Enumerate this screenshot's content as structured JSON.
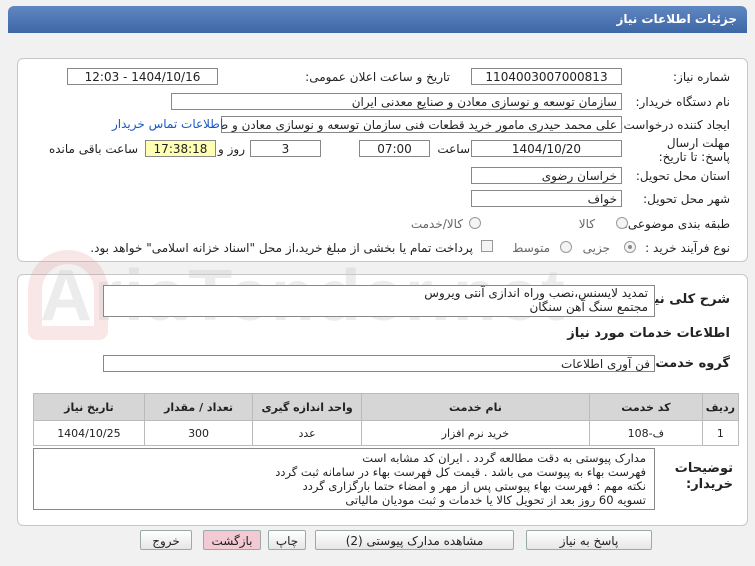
{
  "header": {
    "title": "جزئیات اطلاعات نیاز"
  },
  "form": {
    "need_number_label": "شماره نیاز:",
    "need_number": "1104003007000813",
    "announce_label": "تاریخ و ساعت اعلان عمومی:",
    "announce_value": "1404/10/16 - 12:03",
    "buyer_org_label": "نام دستگاه خریدار:",
    "buyer_org": "سازمان توسعه و نوسازی معادن و صنایع معدنی ایران",
    "creator_label": "ایجاد کننده درخواست:",
    "creator": "علی محمد حیدری مامور خرید قطعات فنی سازمان توسعه و نوسازی معادن و ص",
    "contact_link": "اطلاعات تماس خریدار",
    "deadline_label": "مهلت ارسال پاسخ: تا تاریخ:",
    "deadline_date": "1404/10/20",
    "time_label": "ساعت",
    "deadline_time": "07:00",
    "days_value": "3",
    "days_label": "روز و",
    "remaining_time": "17:38:18",
    "remaining_label": "ساعت باقی مانده",
    "province_label": "استان محل تحویل:",
    "province": "خراسان رضوی",
    "city_label": "شهر محل تحویل:",
    "city": "خواف",
    "category_label": "طبقه بندی موضوعی:",
    "category_options": [
      "کالا",
      "کالا/خدمت"
    ],
    "process_label": "نوع فرآیند خرید :",
    "process_options": [
      "جزیی",
      "متوسط"
    ],
    "payment_note": "پرداخت تمام یا بخشی از مبلغ خرید،از محل \"اسناد خزانه اسلامی\" خواهد بود."
  },
  "summary": {
    "label": "شرح کلی نیاز:",
    "line1": "تمدید لایسنس،نصب وراه اندازی آنتی ویروس",
    "line2": "مجتمع سنگ آهن سنگان"
  },
  "services": {
    "section_title": "اطلاعات خدمات مورد نیاز",
    "group_label": "گروه خدمت:",
    "group_value": "فن آوری اطلاعات",
    "columns": [
      "ردیف",
      "کد خدمت",
      "نام خدمت",
      "واحد اندازه گیری",
      "تعداد / مقدار",
      "تاریخ نیاز"
    ],
    "rows": [
      [
        "1",
        "ف-108",
        "خرید نرم افزار",
        "عدد",
        "300",
        "1404/10/25"
      ]
    ]
  },
  "notes": {
    "label": "توضیحات خریدار:",
    "lines": [
      "مدارک پیوستی به دقت مطالعه گردد . ایران کد مشابه است",
      "فهرست بهاء به پیوست می باشد . قیمت کل فهرست بهاء در سامانه ثبت گردد",
      "نکته مهم : فهرست بهاء پیوستی پس از مهر و امضاء حتما بارگزاری گردد",
      "تسویه 60 روز بعد از تحویل کالا یا خدمات و ثبت مودیان مالیاتی"
    ]
  },
  "buttons": {
    "reply": "پاسخ به نیاز",
    "attachments": "مشاهده مدارک پیوستی (2)",
    "print": "چاپ",
    "back": "بازگشت",
    "exit": "خروج"
  },
  "watermark": "AriaTender.net"
}
